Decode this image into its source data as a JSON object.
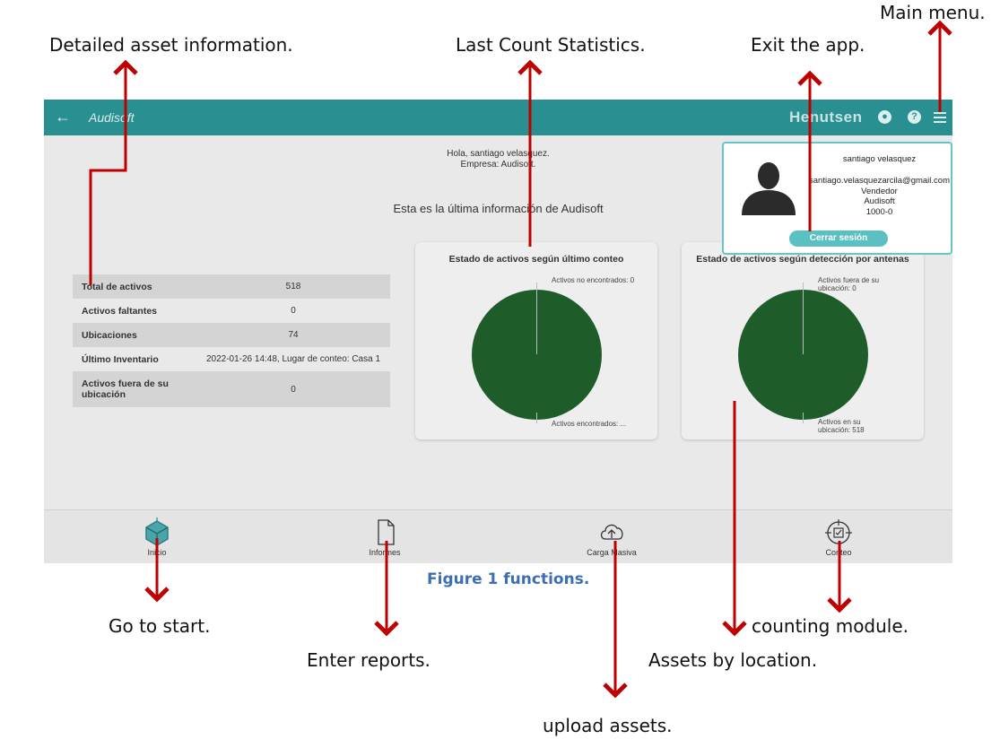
{
  "annotations": {
    "detailed_asset_info": "Detailed asset information.",
    "last_count_stats": "Last Count Statistics.",
    "exit_app": "Exit the app.",
    "main_menu": "Main menu.",
    "go_to_start": "Go to start.",
    "enter_reports": "Enter reports.",
    "upload_assets": "upload assets.",
    "assets_by_location": "Assets by location.",
    "counting_module": "counting module."
  },
  "caption": "Figure 1 functions.",
  "app": {
    "title": "Audisoft",
    "brand": "Henutsen",
    "back_icon": "arrow-left-icon",
    "topbar_icons": [
      "user-icon",
      "help-icon",
      "hamburger-menu-icon"
    ],
    "greeting_line1": "Hola, santiago velasquez.",
    "greeting_line2": "Empresa: Audisoft.",
    "headline": "Esta es la última información de Audisoft",
    "stats": [
      {
        "label": "Total de activos",
        "value": "518"
      },
      {
        "label": "Activos faltantes",
        "value": "0"
      },
      {
        "label": "Ubicaciones",
        "value": "74"
      },
      {
        "label": "Último Inventario",
        "value": "2022-01-26 14:48, Lugar de conteo: Casa 1"
      },
      {
        "label": "Activos fuera de su ubicación",
        "value": "0"
      }
    ],
    "charts": [
      {
        "title": "Estado de activos según último conteo",
        "label_top": "Activos no encontrados: 0",
        "label_bottom": "Activos encontrados: ..."
      },
      {
        "title": "Estado de activos según detección por antenas",
        "label_top": "Activos fuera de su ubicación: 0",
        "label_bottom": "Activos en su ubicación: 518"
      }
    ],
    "nav": [
      {
        "label": "Inicio",
        "icon": "home-cube-icon"
      },
      {
        "label": "Informes",
        "icon": "document-icon"
      },
      {
        "label": "Carga Masiva",
        "icon": "cloud-upload-icon"
      },
      {
        "label": "Conteo",
        "icon": "crosshair-count-icon"
      }
    ],
    "user_popup": {
      "name": "santiago velasquez",
      "email": "santiago.velasquezarcila@gmail.com",
      "role": "Vendedor",
      "company": "Audisoft",
      "code": "1000-0",
      "logout_label": "Cerrar sesión"
    }
  },
  "chart_data": [
    {
      "type": "pie",
      "title": "Estado de activos según último conteo",
      "categories": [
        "Activos no encontrados",
        "Activos encontrados"
      ],
      "values": [
        0,
        518
      ],
      "colors": [
        "#bcbcbc",
        "#1e5c2a"
      ]
    },
    {
      "type": "pie",
      "title": "Estado de activos según detección por antenas",
      "categories": [
        "Activos fuera de su ubicación",
        "Activos en su ubicación"
      ],
      "values": [
        0,
        518
      ],
      "colors": [
        "#bcbcbc",
        "#1e5c2a"
      ]
    }
  ],
  "colors": {
    "topbar": "#2a8f91",
    "pie_green": "#1e5c2a",
    "arrow_red": "#c00000",
    "caption_blue": "#3a6fb3",
    "popup_border": "#66c6c6"
  }
}
